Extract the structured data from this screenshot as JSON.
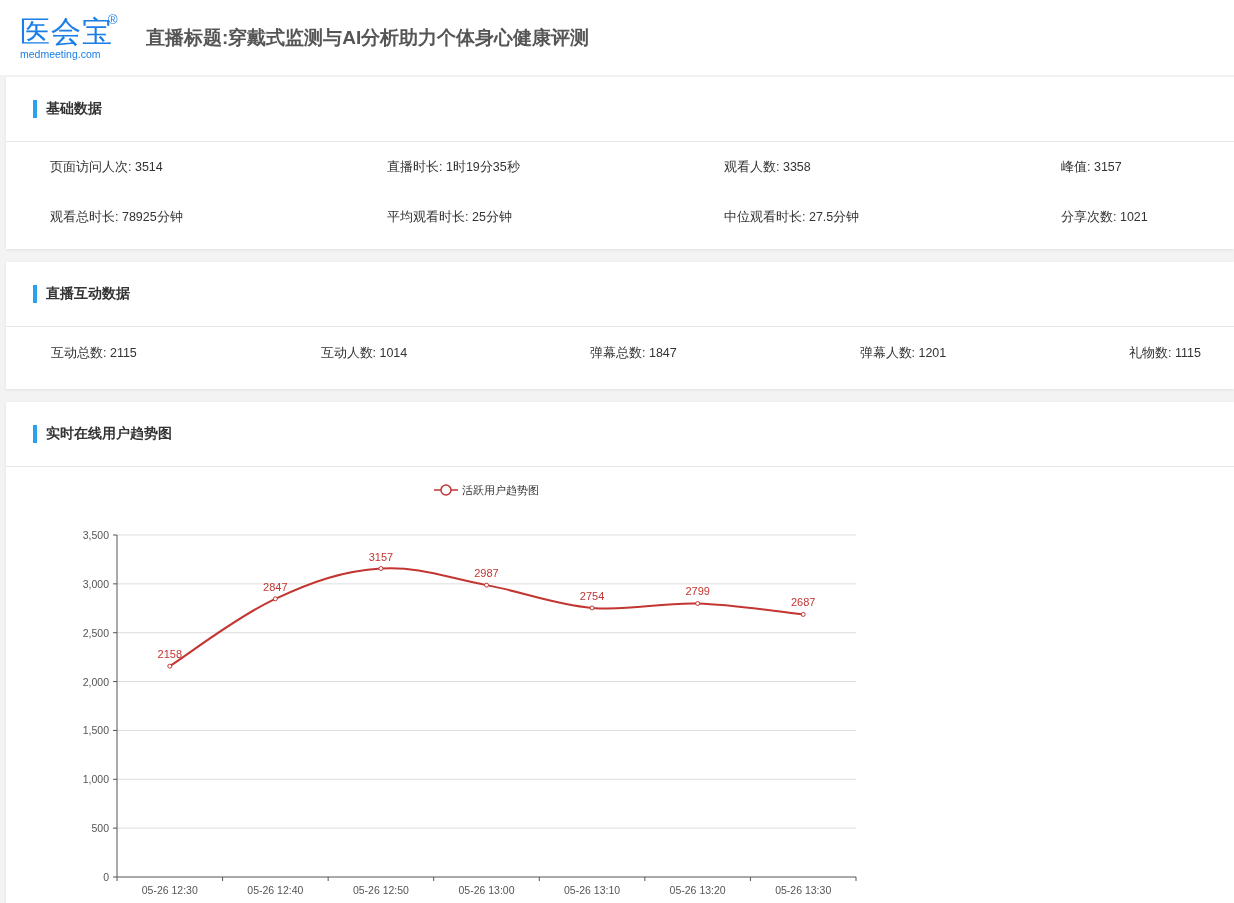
{
  "header": {
    "logo_text": "医会宝",
    "logo_mark": "®",
    "logo_domain": "medmeeting.com",
    "title": "直播标题:穿戴式监测与AI分析助力个体身心健康评测"
  },
  "basic_data": {
    "title": "基础数据",
    "stats": [
      "页面访问人次: 3514",
      "直播时长: 1时19分35秒",
      "观看人数: 3358",
      "峰值: 3157",
      "观看总时长: 78925分钟",
      "平均观看时长: 25分钟",
      "中位观看时长: 27.5分钟",
      "分享次数: 1021"
    ]
  },
  "interaction_data": {
    "title": "直播互动数据",
    "stats": [
      "互动总数: 2115",
      "互动人数: 1014",
      "弹幕总数: 1847",
      "弹幕人数: 1201",
      "礼物数: 1115"
    ]
  },
  "trend": {
    "title": "实时在线用户趋势图",
    "chart_data": {
      "type": "line",
      "categories": [
        "05-26 12:30",
        "05-26 12:40",
        "05-26 12:50",
        "05-26 13:00",
        "05-26 13:10",
        "05-26 13:20",
        "05-26 13:30"
      ],
      "series": [
        {
          "name": "活跃用户趋势图",
          "color": "#c23531",
          "marker": "circle",
          "values": [
            2158,
            2847,
            3157,
            2987,
            2754,
            2799,
            2687
          ]
        }
      ],
      "ylim": [
        0,
        3500
      ],
      "grid": true,
      "yticks": [
        0,
        {
          "value": 500,
          "label": "500"
        },
        {
          "value": 1000,
          "label": "1,000"
        },
        {
          "value": 1500,
          "label": "1,500"
        },
        {
          "value": 2000,
          "label": "2,000"
        },
        {
          "value": 2500,
          "label": "2,500"
        },
        {
          "value": 3000,
          "label": "3,000"
        },
        {
          "value": 3500,
          "label": "3,500"
        }
      ],
      "data_labels": true
    }
  }
}
